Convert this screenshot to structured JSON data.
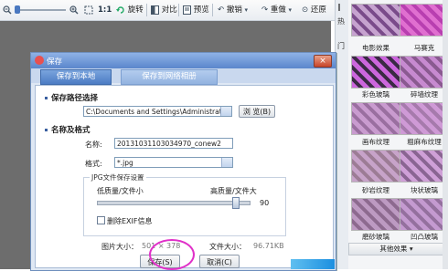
{
  "toolbar": {
    "zoom_ratio": "1:1",
    "rotate": "旋转",
    "contrast": "对比",
    "preview": "预览",
    "undo": "撤销",
    "redo": "重做",
    "restore": "还原"
  },
  "side_strip": {
    "chars": [
      "热",
      "门"
    ]
  },
  "effects": {
    "items": [
      {
        "label": "电影效果",
        "color_a": "#c6a2cf",
        "color_b": "#7a4b8a"
      },
      {
        "label": "马赛克",
        "color_a": "#e06fd0",
        "color_b": "#b83fb0"
      },
      {
        "label": "彩色玻璃",
        "color_a": "#cc66dd",
        "color_b": "#3a2a44"
      },
      {
        "label": "碎墙纹理",
        "color_a": "#c78ad0",
        "color_b": "#8a5a90"
      },
      {
        "label": "画布纹理",
        "color_a": "#c99bcf",
        "color_b": "#9a6fa0"
      },
      {
        "label": "粗麻布纹理",
        "color_a": "#cf9ad6",
        "color_b": "#a67aac"
      },
      {
        "label": "砂岩纹理",
        "color_a": "#c7a3c9",
        "color_b": "#9c7c95"
      },
      {
        "label": "块状玻璃",
        "color_a": "#cfa0d7",
        "color_b": "#8a6592"
      },
      {
        "label": "磨砂玻璃",
        "color_a": "#bd9ac2",
        "color_b": "#8d6a8f"
      },
      {
        "label": "凹凸玻璃",
        "color_a": "#c49ad0",
        "color_b": "#94709e"
      }
    ],
    "more": "其他效果"
  },
  "dialog": {
    "title": "保存",
    "tabs": [
      "保存到本地",
      "保存到网络相册"
    ],
    "path_section": "保存路径选择",
    "path_value": "C:\\Documents and Settings\\Administrator\\J",
    "browse_button": "浏 览(B)",
    "name_section": "名称及格式",
    "name_label": "名称:",
    "name_value": "20131031103034970_conew2",
    "format_label": "格式:",
    "format_value": "*.jpg",
    "jpg_group": "JPG文件保存设置",
    "low_quality": "低质量/文件小",
    "high_quality": "高质量/文件大",
    "quality_value": "90",
    "quality_fraction": 0.9,
    "exif_label": "删除EXIF信息",
    "image_size_label": "图片大小：",
    "image_size_value": "501 × 378",
    "file_size_label": "文件大小：",
    "file_size_value": "96.71KB",
    "save_button": "保存(S)",
    "cancel_button": "取消(C)"
  }
}
